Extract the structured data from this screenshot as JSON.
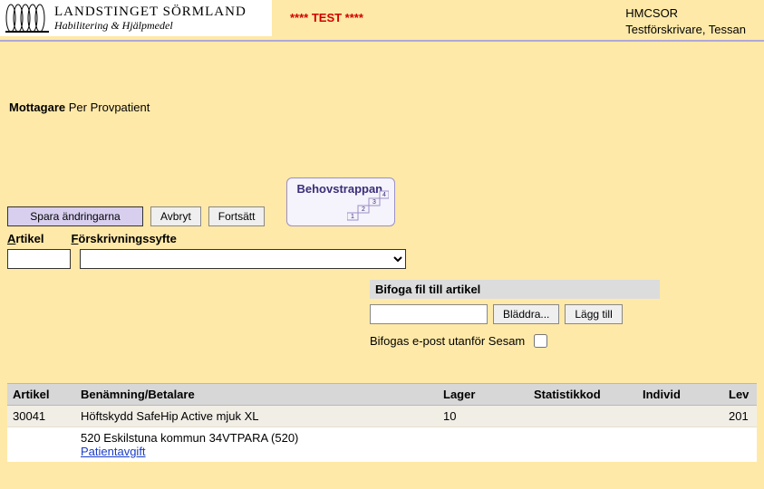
{
  "header": {
    "org_main": "LANDSTINGET SÖRMLAND",
    "org_sub": "Habilitering & Hjälpmedel",
    "test_label": "**** TEST ****",
    "right_line1": "HMCSOR",
    "right_line2": "Testförskrivare, Tessan"
  },
  "recipient": {
    "label": "Mottagare",
    "name": "Per Provpatient"
  },
  "toolbar": {
    "save": "Spara ändringarna",
    "cancel": "Avbryt",
    "continue": "Fortsätt"
  },
  "behov": {
    "title": "Behovstrappan",
    "steps": [
      "1",
      "2",
      "3",
      "4"
    ]
  },
  "form": {
    "artikel_label_u": "A",
    "artikel_label_rest": "rtikel",
    "syfte_label_u": "F",
    "syfte_label_rest": "örskrivningssyfte",
    "artikel_value": "",
    "syfte_value": ""
  },
  "file": {
    "title": "Bifoga fil till artikel",
    "browse": "Bläddra...",
    "add": "Lägg till",
    "epost_label": "Bifogas e-post utanför Sesam",
    "epost_checked": false
  },
  "grid": {
    "headers": {
      "artikel": "Artikel",
      "benamning": "Benämning/Betalare",
      "lager": "Lager",
      "statistikkod": "Statistikkod",
      "individ": "Individ",
      "lev": "Lev"
    },
    "row": {
      "artikel": "30041",
      "benamning": "Höftskydd SafeHip Active mjuk XL",
      "lager": "10",
      "statistikkod": "",
      "individ": "",
      "lev": "201"
    },
    "subrow": {
      "betalare": "520 Eskilstuna kommun 34VTPARA (520)",
      "link": "Patientavgift"
    }
  }
}
